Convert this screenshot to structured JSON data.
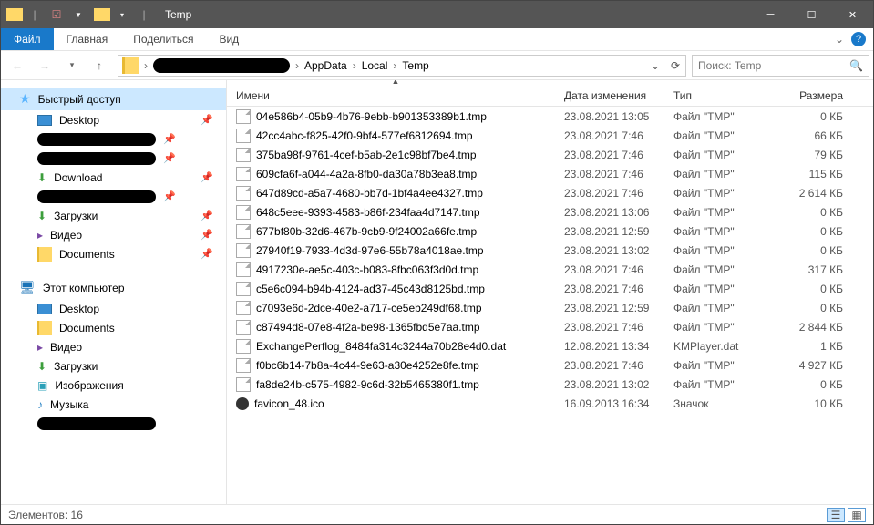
{
  "title": "Temp",
  "menu": {
    "file": "Файл",
    "home": "Главная",
    "share": "Поделиться",
    "view": "Вид"
  },
  "nav": {
    "crumbs": [
      "AppData",
      "Local",
      "Temp"
    ],
    "search_placeholder": "Поиск: Temp"
  },
  "sidebar": {
    "quick": "Быстрый доступ",
    "thispc": "Этот компьютер",
    "items_quick": [
      {
        "label": "Desktop",
        "icon": "desktop"
      },
      {
        "label": "",
        "icon": "redacted"
      },
      {
        "label": "",
        "icon": "redacted"
      },
      {
        "label": "Download",
        "icon": "download"
      },
      {
        "label": "",
        "icon": "redacted"
      },
      {
        "label": "Загрузки",
        "icon": "download"
      },
      {
        "label": "Видео",
        "icon": "video"
      },
      {
        "label": "Documents",
        "icon": "folder"
      }
    ],
    "items_pc": [
      {
        "label": "Desktop",
        "icon": "desktop"
      },
      {
        "label": "Documents",
        "icon": "folder"
      },
      {
        "label": "Видео",
        "icon": "video"
      },
      {
        "label": "Загрузки",
        "icon": "download"
      },
      {
        "label": "Изображения",
        "icon": "picture"
      },
      {
        "label": "Музыка",
        "icon": "music"
      },
      {
        "label": "",
        "icon": "redacted"
      }
    ]
  },
  "columns": {
    "name": "Имени",
    "date": "Дата изменения",
    "type": "Тип",
    "size": "Размера"
  },
  "rows": [
    {
      "name": "04e586b4-05b9-4b76-9ebb-b901353389b1.tmp",
      "date": "23.08.2021 13:05",
      "type": "Файл \"TMP\"",
      "size": "0 КБ"
    },
    {
      "name": "42cc4abc-f825-42f0-9bf4-577ef6812694.tmp",
      "date": "23.08.2021 7:46",
      "type": "Файл \"TMP\"",
      "size": "66 КБ"
    },
    {
      "name": "375ba98f-9761-4cef-b5ab-2e1c98bf7be4.tmp",
      "date": "23.08.2021 7:46",
      "type": "Файл \"TMP\"",
      "size": "79 КБ"
    },
    {
      "name": "609cfa6f-a044-4a2a-8fb0-da30a78b3ea8.tmp",
      "date": "23.08.2021 7:46",
      "type": "Файл \"TMP\"",
      "size": "115 КБ"
    },
    {
      "name": "647d89cd-a5a7-4680-bb7d-1bf4a4ee4327.tmp",
      "date": "23.08.2021 7:46",
      "type": "Файл \"TMP\"",
      "size": "2 614 КБ"
    },
    {
      "name": "648c5eee-9393-4583-b86f-234faa4d7147.tmp",
      "date": "23.08.2021 13:06",
      "type": "Файл \"TMP\"",
      "size": "0 КБ"
    },
    {
      "name": "677bf80b-32d6-467b-9cb9-9f24002a66fe.tmp",
      "date": "23.08.2021 12:59",
      "type": "Файл \"TMP\"",
      "size": "0 КБ"
    },
    {
      "name": "27940f19-7933-4d3d-97e6-55b78a4018ae.tmp",
      "date": "23.08.2021 13:02",
      "type": "Файл \"TMP\"",
      "size": "0 КБ"
    },
    {
      "name": "4917230e-ae5c-403c-b083-8fbc063f3d0d.tmp",
      "date": "23.08.2021 7:46",
      "type": "Файл \"TMP\"",
      "size": "317 КБ"
    },
    {
      "name": "c5e6c094-b94b-4124-ad37-45c43d8125bd.tmp",
      "date": "23.08.2021 7:46",
      "type": "Файл \"TMP\"",
      "size": "0 КБ"
    },
    {
      "name": "c7093e6d-2dce-40e2-a717-ce5eb249df68.tmp",
      "date": "23.08.2021 12:59",
      "type": "Файл \"TMP\"",
      "size": "0 КБ"
    },
    {
      "name": "c87494d8-07e8-4f2a-be98-1365fbd5e7aa.tmp",
      "date": "23.08.2021 7:46",
      "type": "Файл \"TMP\"",
      "size": "2 844 КБ"
    },
    {
      "name": "ExchangePerflog_8484fa314c3244a70b28e4d0.dat",
      "date": "12.08.2021 13:34",
      "type": "KMPlayer.dat",
      "size": "1 КБ"
    },
    {
      "name": "f0bc6b14-7b8a-4c44-9e63-a30e4252e8fe.tmp",
      "date": "23.08.2021 7:46",
      "type": "Файл \"TMP\"",
      "size": "4 927 КБ"
    },
    {
      "name": "fa8de24b-c575-4982-9c6d-32b5465380f1.tmp",
      "date": "23.08.2021 13:02",
      "type": "Файл \"TMP\"",
      "size": "0 КБ"
    },
    {
      "name": "favicon_48.ico",
      "date": "16.09.2013 16:34",
      "type": "Значок",
      "size": "10 КБ",
      "icon": "ico"
    }
  ],
  "status": "Элементов: 16"
}
